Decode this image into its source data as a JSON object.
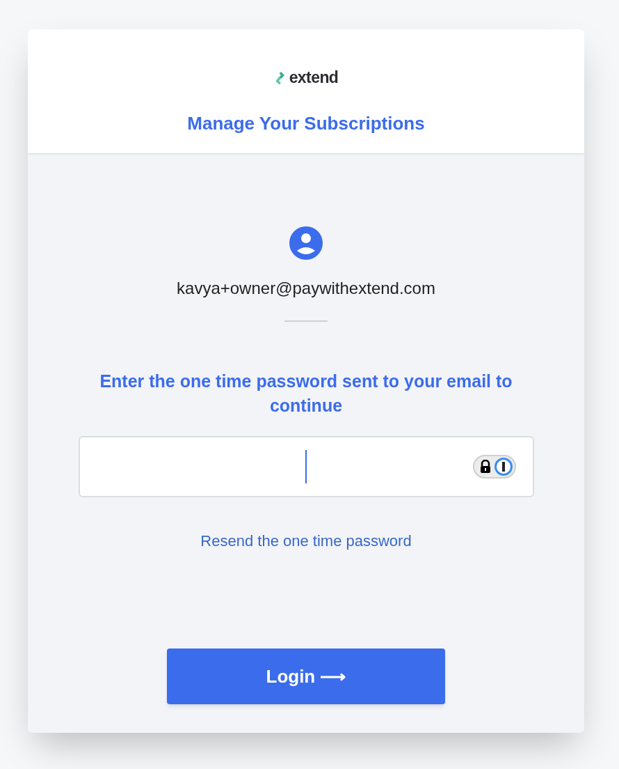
{
  "brand": {
    "name": "extend"
  },
  "header": {
    "title": "Manage Your Subscriptions"
  },
  "account": {
    "email": "kavya+owner@paywithextend.com"
  },
  "prompt": "Enter the one time password sent to your email to continue",
  "resend_link": "Resend the one time password",
  "login_button": {
    "label": "Login ⟶"
  }
}
